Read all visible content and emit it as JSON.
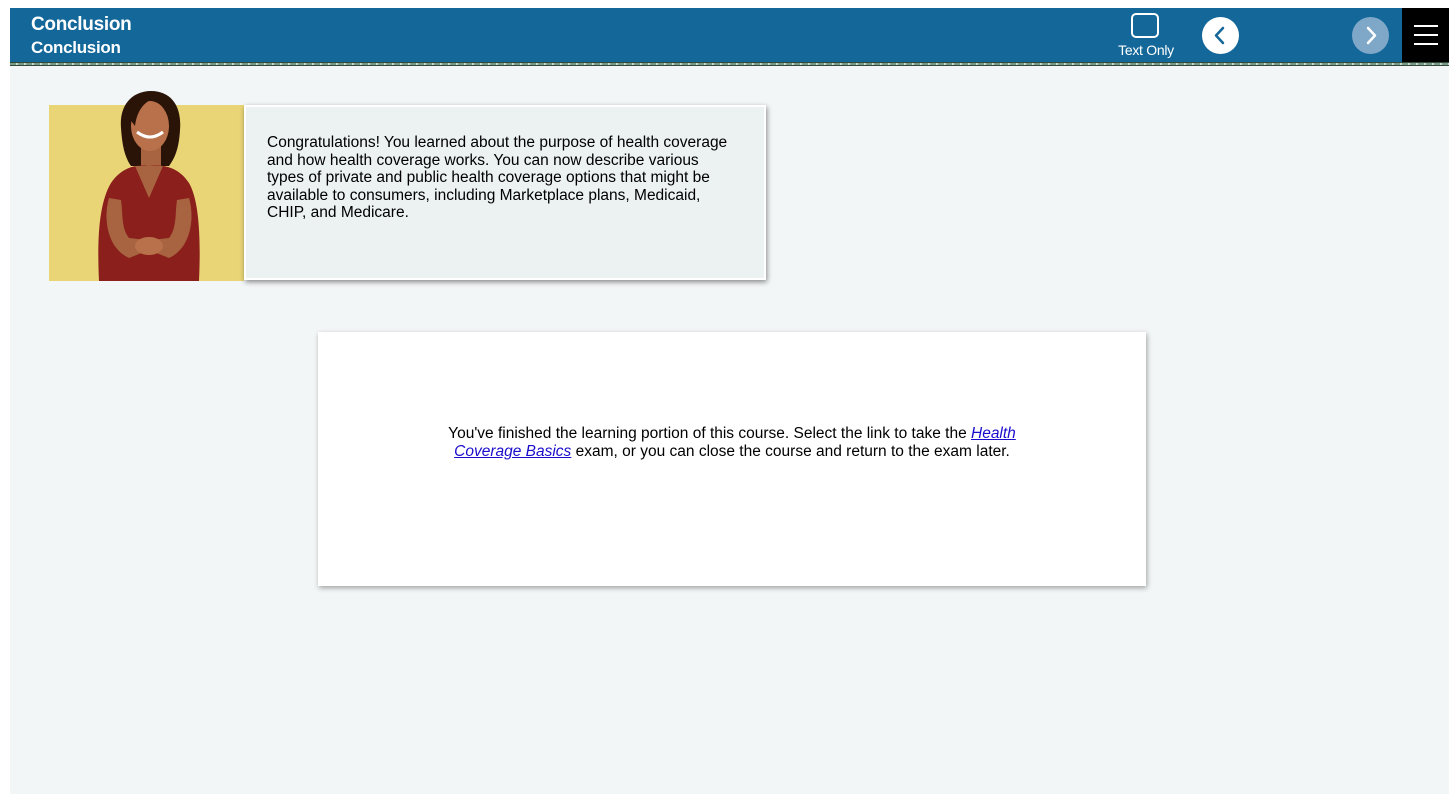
{
  "header": {
    "title": "Conclusion",
    "subtitle": "Conclusion",
    "text_only_label": "Text Only",
    "back_icon": "chevron-left-icon",
    "next_icon": "chevron-right-icon",
    "menu_icon": "hamburger-menu-icon"
  },
  "intro": {
    "avatar_icon": "presenter-avatar",
    "text": "Congratulations! You learned about the purpose of health coverage and how health coverage works. You can now describe various types of private and public health coverage options that might be available to consumers, including Marketplace plans, Medicaid, CHIP, and Medicare."
  },
  "completion": {
    "text_before": "You've finished the learning portion of this course. Select the link to take the ",
    "link_text": "Health Coverage Basics",
    "text_after": " exam, or you can close the course and return to the exam later."
  },
  "colors": {
    "header": "#146799",
    "page_bg": "#f3f6f7",
    "avatar_bg": "#e9d576",
    "link": "#1a0dcc"
  }
}
